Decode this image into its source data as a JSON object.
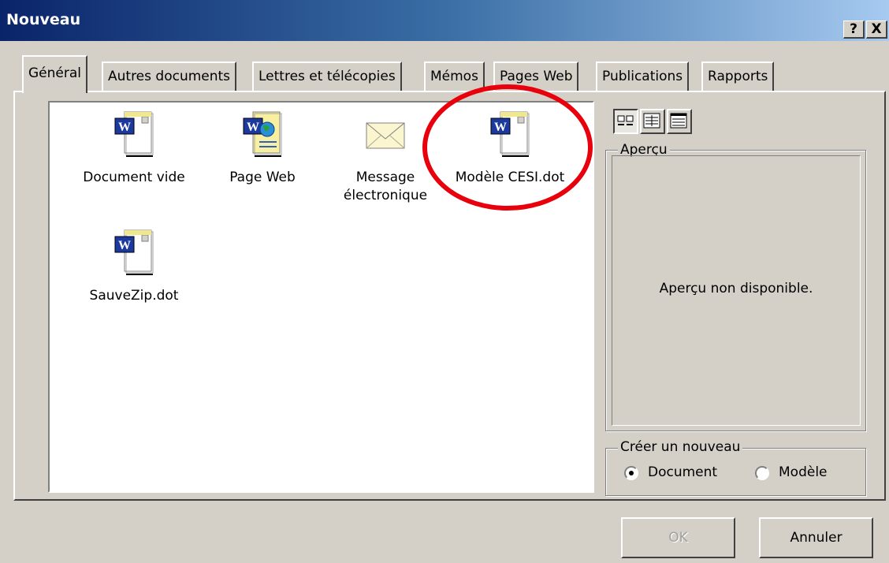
{
  "window": {
    "title": "Nouveau",
    "help_button": "?",
    "close_button": "X"
  },
  "tabs": [
    {
      "label": "Général",
      "active": true
    },
    {
      "label": "Autres documents"
    },
    {
      "label": "Lettres et télécopies"
    },
    {
      "label": "Mémos"
    },
    {
      "label": "Pages Web"
    },
    {
      "label": "Publications"
    },
    {
      "label": "Rapports"
    }
  ],
  "templates": [
    {
      "label": "Document vide",
      "icon": "word-document-icon"
    },
    {
      "label": "Page Web",
      "icon": "word-web-page-icon"
    },
    {
      "label_line1": "Message",
      "label_line2": "électronique",
      "icon": "envelope-icon"
    },
    {
      "label": "Modèle CESI.dot",
      "icon": "word-template-icon",
      "highlighted": true
    },
    {
      "label": "SauveZip.dot",
      "icon": "word-template-icon"
    }
  ],
  "view_buttons": [
    "large-icons-view-icon",
    "list-view-icon",
    "details-view-icon"
  ],
  "preview": {
    "label": "Aperçu",
    "message": "Aperçu non disponible."
  },
  "create_new": {
    "label": "Créer un nouveau",
    "options": [
      {
        "label": "Document",
        "selected": true
      },
      {
        "label": "Modèle",
        "selected": false
      }
    ]
  },
  "buttons": {
    "ok": "OK",
    "cancel": "Annuler"
  },
  "colors": {
    "highlight_circle": "#e8000c",
    "titlebar_start": "#0a246a",
    "titlebar_end": "#a6caf0"
  }
}
